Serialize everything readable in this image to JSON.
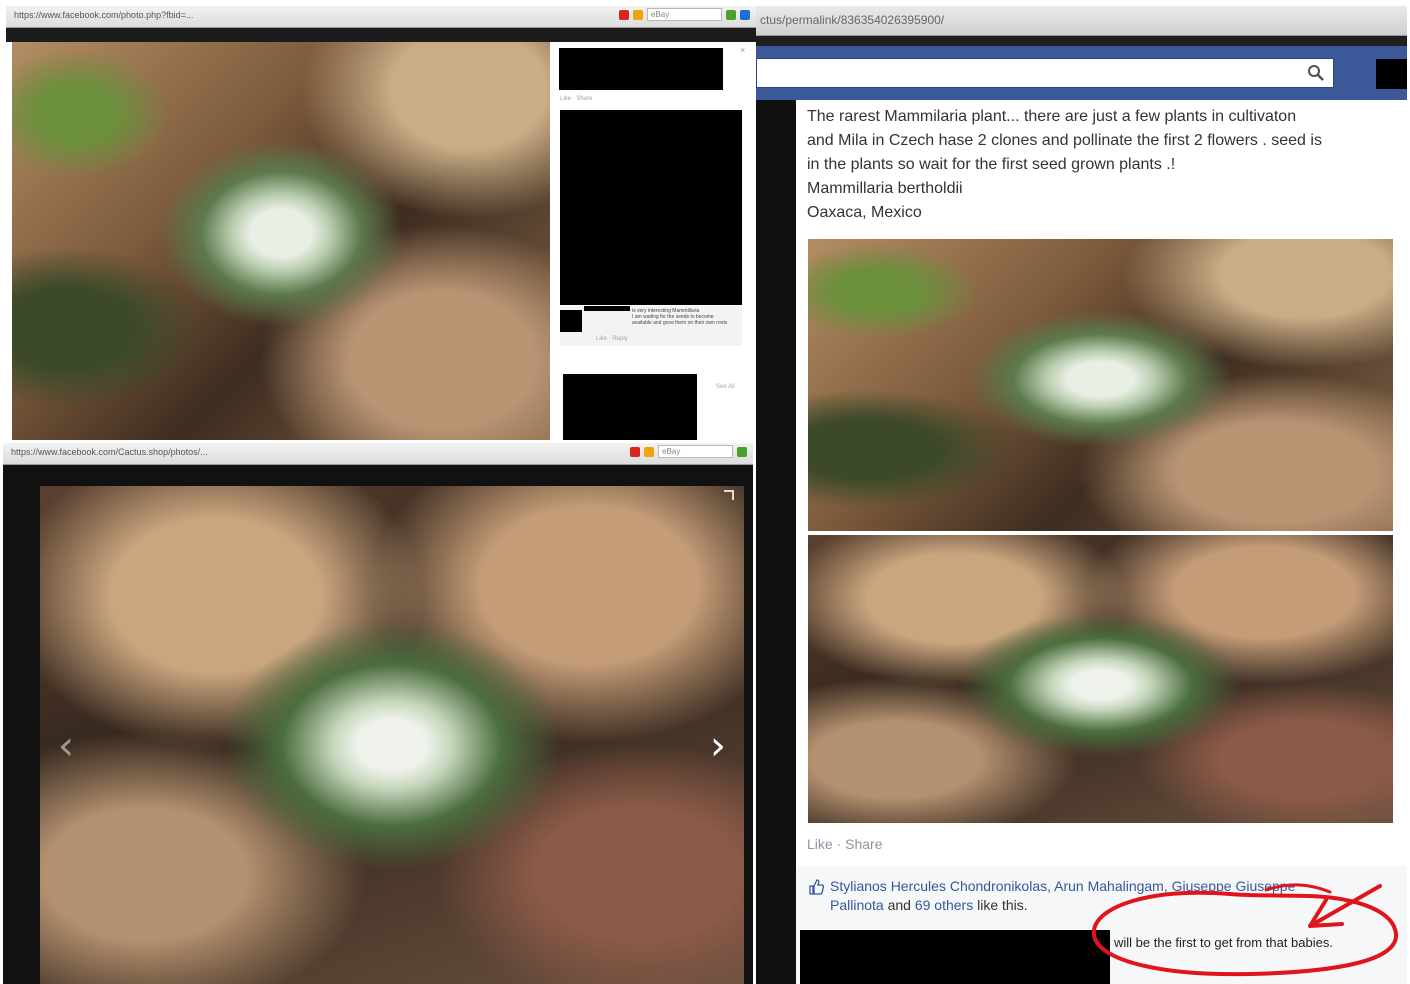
{
  "left_top_window": {
    "url": "https://www.facebook.com/photo.php?fbid=...",
    "browser_search_placeholder": "eBay",
    "sidebar": {
      "actions": "Like · Share",
      "comment_lines": [
        "is very interesting Mammillaria",
        "I am waiting for the seeds to become",
        "available and grow them on their own roots"
      ],
      "comment_actions": "Like · Reply",
      "view_more": "See All"
    },
    "icon_colors": [
      "#d9261c",
      "#f0a30a",
      "#4aa02c",
      "#1d6fd6"
    ]
  },
  "left_bottom_window": {
    "url": "https://www.facebook.com/Cactus.shop/photos/...",
    "browser_search_placeholder": "eBay",
    "prev_arrow": "‹",
    "next_arrow": "›"
  },
  "right_window": {
    "url": "ctus/permalink/836354026395900/",
    "search_icon": "magnifier-icon",
    "post_text_lines": [
      "The rarest Mammilaria plant... there are just a few plants in cultivaton",
      "and Mila in Czech hase 2 clones and pollinate the first 2 flowers . seed is",
      "in the plants so wait for the first seed grown plants .!",
      "Mammillaria bertholdii",
      "Oaxaca, Mexico"
    ],
    "actions": "Like · Share",
    "likes_line_1": "Stylianos Hercules Chondronikolas, Arun Mahalingam, Giuseppe Giuseppe",
    "likes_line_2_link": "Pallinota",
    "likes_line_2_mid": " and ",
    "likes_line_2_others": "69 others",
    "likes_line_2_end": " like this.",
    "comment_text": "will be the first to get from that babies.",
    "annotation_color": "#e0151b"
  },
  "colors": {
    "facebook_blue": "#3b5998",
    "redaction": "#000000"
  }
}
